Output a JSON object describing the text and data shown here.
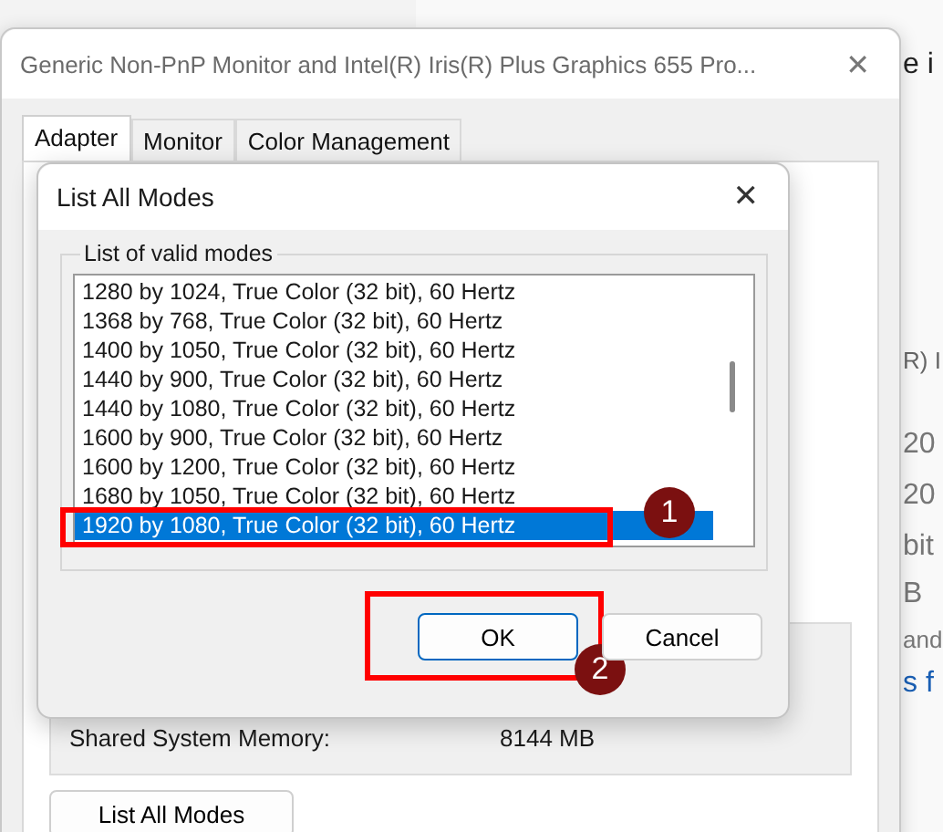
{
  "background_window": {
    "fragments": [
      "e i",
      "R) I",
      "20",
      "20",
      "bit",
      "B",
      "and",
      "s f"
    ]
  },
  "properties_window": {
    "title": "Generic Non-PnP Monitor and Intel(R) Iris(R) Plus Graphics 655 Pro...",
    "close": "✕",
    "tabs": [
      {
        "label": "Adapter",
        "selected": true
      },
      {
        "label": "Monitor",
        "selected": false
      },
      {
        "label": "Color Management",
        "selected": false
      }
    ],
    "memory": {
      "label": "Shared System Memory:",
      "value": "8144 MB"
    },
    "list_all_modes_button": "List All Modes"
  },
  "dialog": {
    "title": "List All Modes",
    "close": "✕",
    "group_label": "List of valid modes",
    "modes": [
      {
        "label": "1280 by 1024, True Color (32 bit), 60 Hertz",
        "selected": false
      },
      {
        "label": "1368 by 768, True Color (32 bit), 60 Hertz",
        "selected": false
      },
      {
        "label": "1400 by 1050, True Color (32 bit), 60 Hertz",
        "selected": false
      },
      {
        "label": "1440 by 900, True Color (32 bit), 60 Hertz",
        "selected": false
      },
      {
        "label": "1440 by 1080, True Color (32 bit), 60 Hertz",
        "selected": false
      },
      {
        "label": "1600 by 900, True Color (32 bit), 60 Hertz",
        "selected": false
      },
      {
        "label": "1600 by 1200, True Color (32 bit), 60 Hertz",
        "selected": false
      },
      {
        "label": "1680 by 1050, True Color (32 bit), 60 Hertz",
        "selected": false
      },
      {
        "label": "1920 by 1080, True Color (32 bit), 60 Hertz",
        "selected": true
      }
    ],
    "buttons": [
      {
        "label": "OK",
        "kind": "default"
      },
      {
        "label": "Cancel",
        "kind": "normal"
      }
    ]
  },
  "annotations": [
    {
      "label": "1"
    },
    {
      "label": "2"
    }
  ]
}
